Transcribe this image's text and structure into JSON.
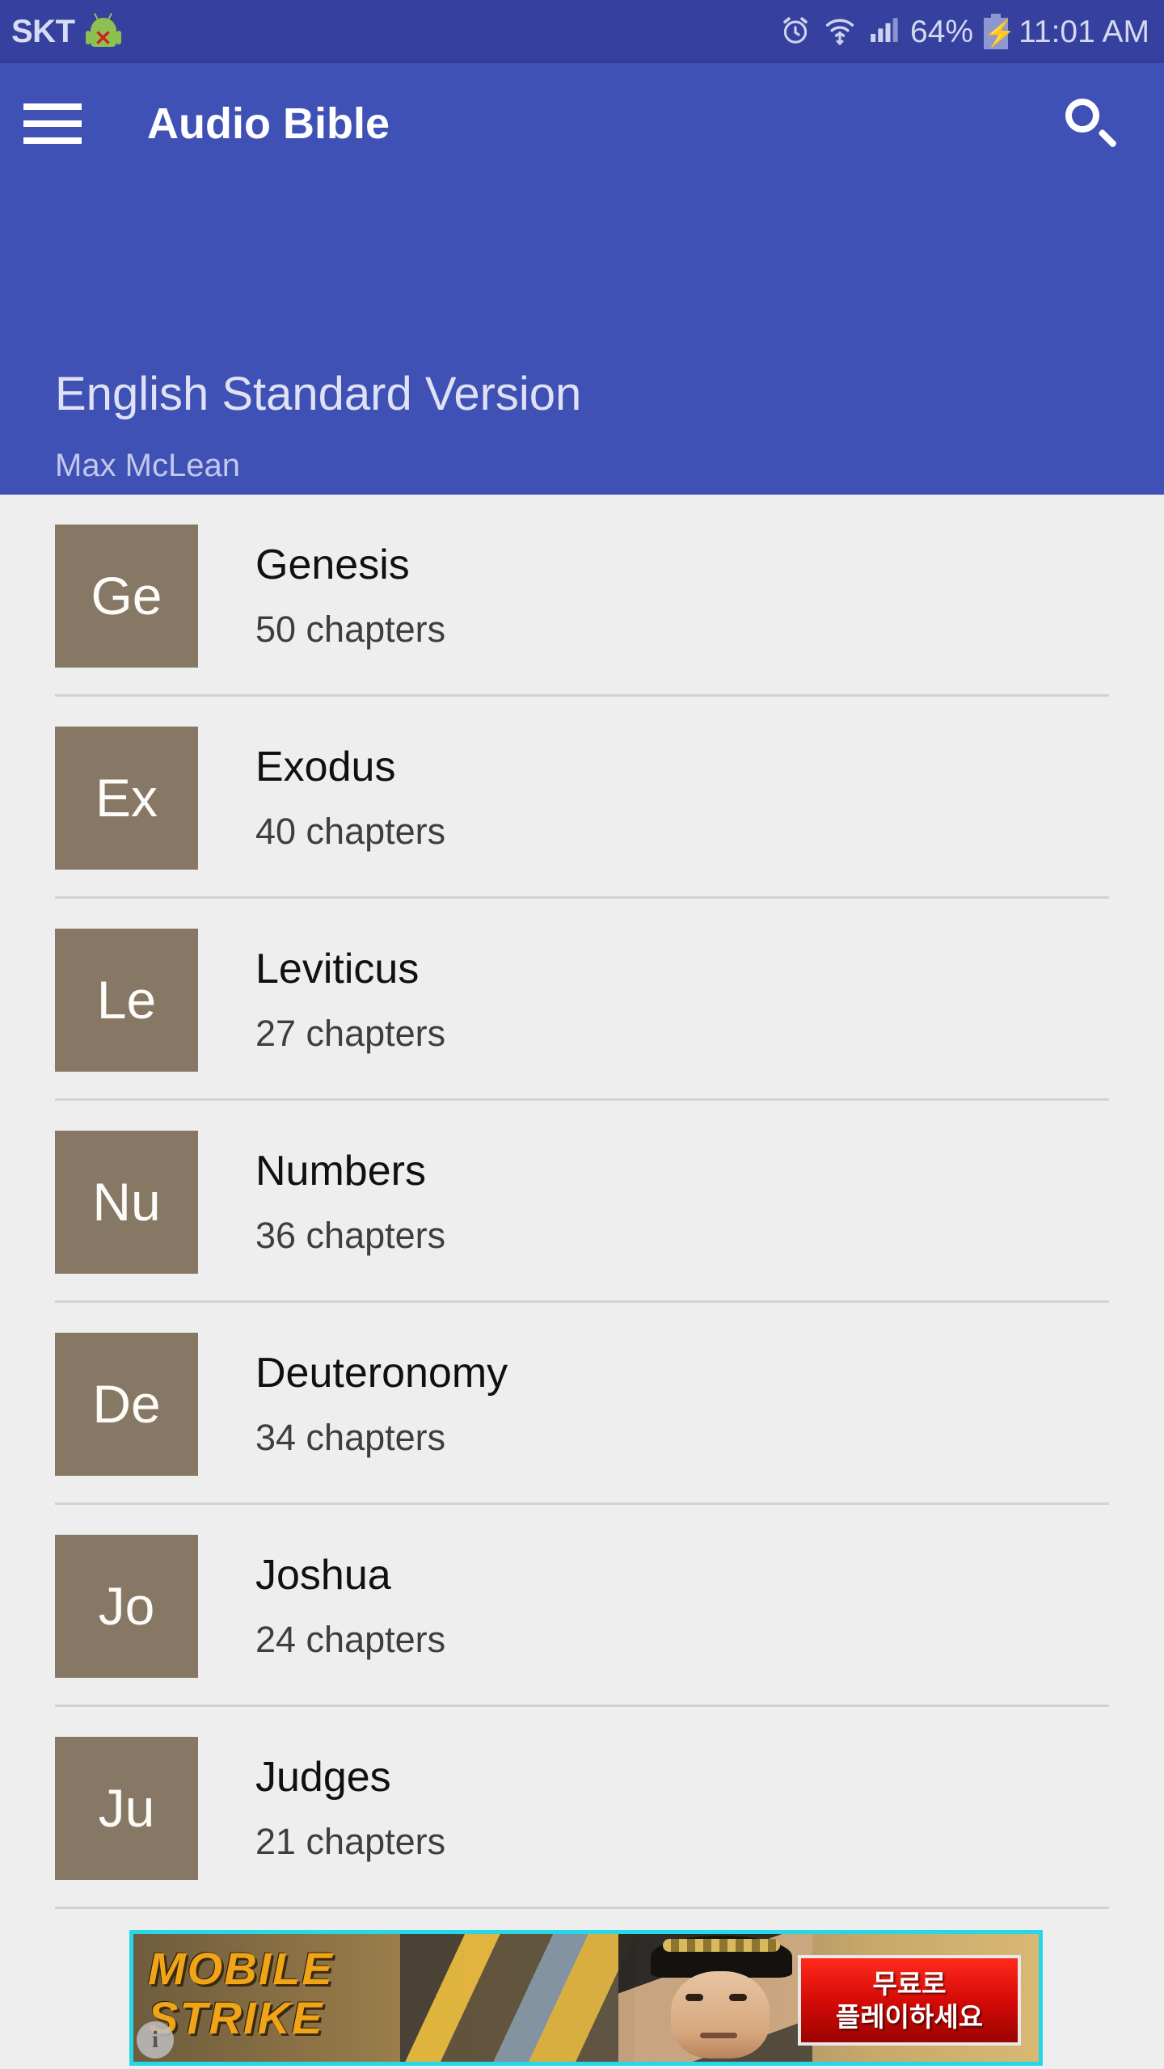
{
  "status_bar": {
    "carrier": "SKT",
    "android_icon": "android-robot-icon",
    "x_mark": "✕",
    "alarm_icon": "alarm-clock-icon",
    "wifi_icon": "wifi-icon",
    "signal_icon": "cellular-signal-icon",
    "battery_percent": "64%",
    "battery_icon": "battery-charging-icon",
    "battery_bolt": "⚡",
    "time": "11:01 AM",
    "background_color": "#36409e",
    "text_color": "#d4d9f0"
  },
  "toolbar": {
    "menu_icon": "hamburger-menu-icon",
    "title": "Audio Bible",
    "search_icon": "search-icon",
    "background_color": "#3f51b5"
  },
  "version_header": {
    "title": "English Standard Version",
    "narrator": "Max McLean"
  },
  "book_list": {
    "tile_color": "#877865",
    "background_color": "#eeeeee",
    "books": [
      {
        "abbr": "Ge",
        "name": "Genesis",
        "chapters": "50 chapters"
      },
      {
        "abbr": "Ex",
        "name": "Exodus",
        "chapters": "40 chapters"
      },
      {
        "abbr": "Le",
        "name": "Leviticus",
        "chapters": "27 chapters"
      },
      {
        "abbr": "Nu",
        "name": "Numbers",
        "chapters": "36 chapters"
      },
      {
        "abbr": "De",
        "name": "Deuteronomy",
        "chapters": "34 chapters"
      },
      {
        "abbr": "Jo",
        "name": "Joshua",
        "chapters": "24 chapters"
      },
      {
        "abbr": "Ju",
        "name": "Judges",
        "chapters": "21 chapters"
      }
    ]
  },
  "ad_banner": {
    "title_line1": "MOBILE",
    "title_line2": "STRIKE",
    "cta_line1": "무료로",
    "cta_line2": "플레이하세요",
    "info_badge": "i",
    "border_color": "#26d7e8",
    "cta_color": "#d60b07"
  }
}
